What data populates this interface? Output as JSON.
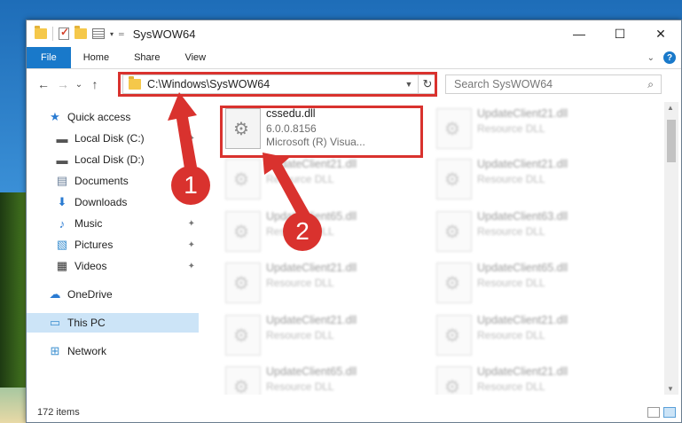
{
  "window": {
    "title": "SysWOW64",
    "min_glyph": "—",
    "max_glyph": "☐",
    "close_glyph": "✕"
  },
  "ribbon": {
    "tabs": [
      "File",
      "Home",
      "Share",
      "View"
    ]
  },
  "nav": {
    "back_glyph": "←",
    "forward_glyph": "→",
    "recent_glyph": "⌄",
    "up_glyph": "↑",
    "address_path": "C:\\Windows\\SysWOW64",
    "refresh_glyph": "↻",
    "search_placeholder": "Search SysWOW64"
  },
  "sidebar": {
    "items": [
      {
        "label": "Quick access",
        "icon": "star-icon"
      },
      {
        "label": "Local Disk (C:)",
        "icon": "drive-icon"
      },
      {
        "label": "Local Disk (D:)",
        "icon": "drive-icon"
      },
      {
        "label": "Documents",
        "icon": "documents-icon"
      },
      {
        "label": "Downloads",
        "icon": "download-icon"
      },
      {
        "label": "Music",
        "icon": "music-icon"
      },
      {
        "label": "Pictures",
        "icon": "pictures-icon"
      },
      {
        "label": "Videos",
        "icon": "videos-icon"
      },
      {
        "label": "OneDrive",
        "icon": "cloud-icon"
      },
      {
        "label": "This PC",
        "icon": "computer-icon"
      },
      {
        "label": "Network",
        "icon": "network-icon"
      }
    ]
  },
  "files": [
    {
      "name": "cssedu.dll",
      "line2": "6.0.0.8156",
      "line3": "Microsoft (R) Visua...",
      "highlight": true
    },
    {
      "name": "UpdateClient21.dll",
      "line2": "Resource DLL"
    },
    {
      "name": "UpdateClient21.dll",
      "line2": "Resource DLL"
    },
    {
      "name": "UpdateClient21.dll",
      "line2": "Resource DLL"
    },
    {
      "name": "UpdateClient65.dll",
      "line2": "Resource DLL"
    },
    {
      "name": "UpdateClient63.dll",
      "line2": "Resource DLL"
    },
    {
      "name": "UpdateClient21.dll",
      "line2": "Resource DLL"
    },
    {
      "name": "UpdateClient65.dll",
      "line2": "Resource DLL"
    },
    {
      "name": "UpdateClient21.dll",
      "line2": "Resource DLL"
    },
    {
      "name": "UpdateClient21.dll",
      "line2": "Resource DLL"
    },
    {
      "name": "UpdateClient65.dll",
      "line2": "Resource DLL"
    },
    {
      "name": "UpdateClient21.dll",
      "line2": "Resource DLL"
    }
  ],
  "status": {
    "count": "172 items"
  },
  "annotations": {
    "step1": "1",
    "step2": "2",
    "color": "#d9322e"
  }
}
